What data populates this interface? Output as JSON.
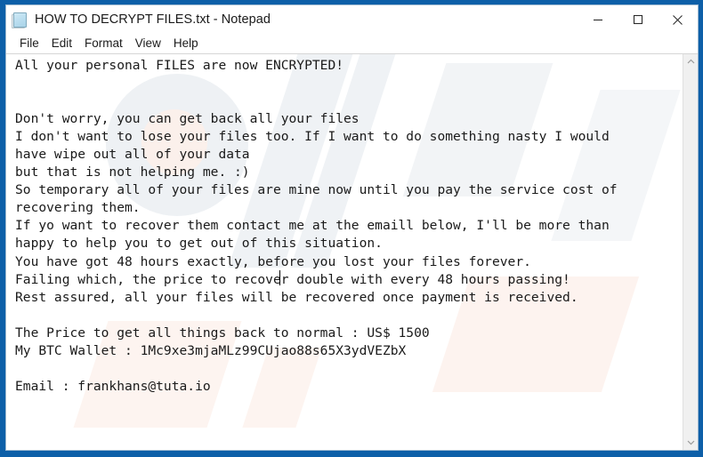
{
  "window": {
    "title": "HOW TO DECRYPT FILES.txt - Notepad",
    "app_icon": "notepad-document-icon",
    "frame_color": "#0d5fa8",
    "background": "#ffffff"
  },
  "window_controls": {
    "minimize": {
      "name": "minimize-button",
      "glyph": "—"
    },
    "maximize": {
      "name": "maximize-button",
      "glyph": "□"
    },
    "close": {
      "name": "close-button",
      "glyph": "✕"
    }
  },
  "menubar": {
    "items": [
      {
        "label": "File"
      },
      {
        "label": "Edit"
      },
      {
        "label": "Format"
      },
      {
        "label": "View"
      },
      {
        "label": "Help"
      }
    ]
  },
  "document": {
    "filename": "HOW TO DECRYPT FILES.txt",
    "lines": [
      "All your personal FILES are now ENCRYPTED!",
      "",
      "",
      "Don't worry, you can get back all your files",
      "I don't want to lose your files too. If I want to do something nasty I would",
      "have wipe out all of your data",
      "but that is not helping me. :)",
      "So temporary all of your files are mine now until you pay the service cost of",
      "recovering them.",
      "If yo want to recover them contact me at the emaill below, I'll be more than",
      "happy to help you to get out of this situation.",
      "You have got 48 hours exactly, before you lost your files forever.",
      "Failing which, the price to recover double with every 48 hours passing!",
      "Rest assured, all your files will be recovered once payment is received.",
      "",
      "The Price to get all things back to normal : US$ 1500",
      "My BTC Wallet : 1Mc9xe3mjaMLz99CUjao88s65X3ydVEZbX",
      "",
      "Email : frankhans@tuta.io"
    ],
    "ransom_details": {
      "price": "US$ 1500",
      "btc_wallet": "1Mc9xe3mjaMLz99CUjao88s65X3ydVEZbX",
      "email": "frankhans@tuta.io",
      "deadline": "48 hours"
    },
    "text_color": "#1a1a1a"
  },
  "scrollbar": {
    "up_arrow": "scroll-up-arrow",
    "down_arrow": "scroll-down-arrow",
    "orientation": "vertical"
  }
}
